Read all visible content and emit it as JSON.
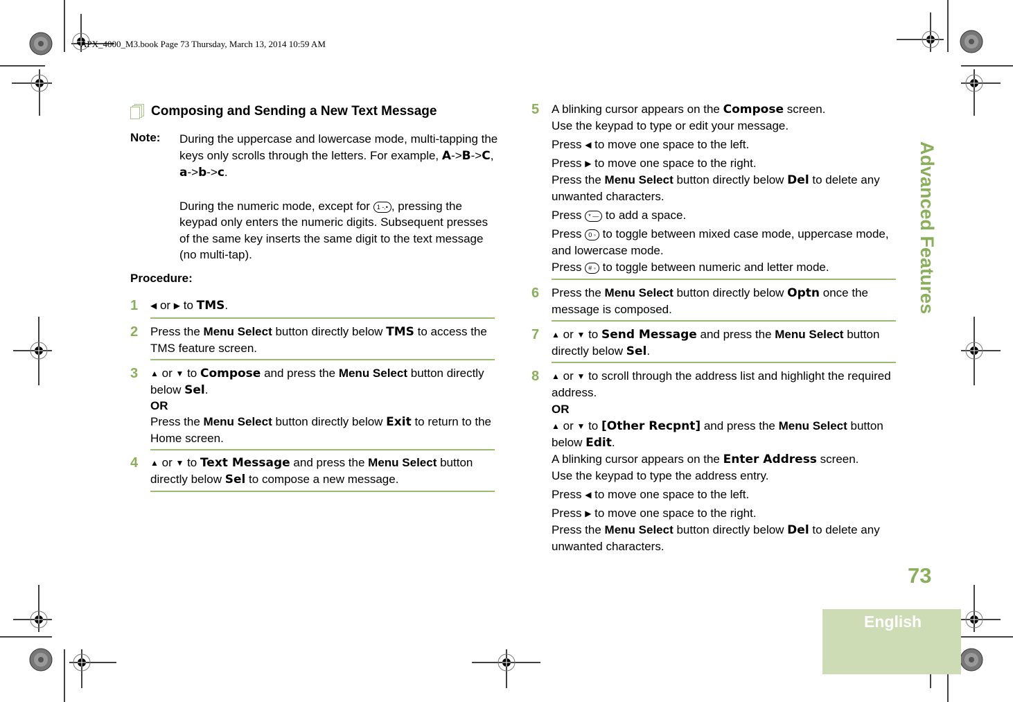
{
  "print_stamp": "APX_4000_M3.book  Page 73  Thursday, March 13, 2014  10:59 AM",
  "section": {
    "title": "Composing and Sending a New Text Message",
    "icon": "document-stack-icon"
  },
  "note": {
    "label": "Note:",
    "para1_a": "During the uppercase and lowercase mode, multi-tapping the keys only scrolls through the letters. For example, ",
    "example": [
      {
        "t": "A",
        "d": true
      },
      {
        "t": "->",
        "d": false
      },
      {
        "t": "B",
        "d": true
      },
      {
        "t": "->",
        "d": false
      },
      {
        "t": "C",
        "d": true
      },
      {
        "t": ", ",
        "d": false
      },
      {
        "t": "a",
        "d": true
      },
      {
        "t": "->",
        "d": false
      },
      {
        "t": "b",
        "d": true
      },
      {
        "t": "->",
        "d": false
      },
      {
        "t": "c",
        "d": true
      },
      {
        "t": ".",
        "d": false
      }
    ],
    "para2_a": "During the numeric mode, except for ",
    "key_1": "1 -.•",
    "para2_b": ", pressing the keypad only enters the numeric digits. Subsequent presses of the same key inserts the same digit to the text message (no multi-tap)."
  },
  "procedure_label": "Procedure:",
  "icons": {
    "left": "◀",
    "right": "▶",
    "up": "▲",
    "down": "▼"
  },
  "keys": {
    "star": "* —",
    "zero": "0 ◦",
    "hash": "# ◦"
  },
  "steps": [
    {
      "num": "1",
      "or": " or ",
      "to": " to ",
      "target": "TMS",
      "end": "."
    },
    {
      "num": "2",
      "a": "Press the ",
      "ms": "Menu Select",
      "b": " button directly below ",
      "d": "TMS",
      "c": " to access the TMS feature screen."
    },
    {
      "num": "3",
      "or": " or ",
      "to": " to ",
      "target": "Compose",
      "a": " and press the ",
      "ms": "Menu Select",
      "b": " button directly below ",
      "d": "Sel",
      "end": ".",
      "or_label": "OR",
      "alt_a": "Press the ",
      "alt_ms": "Menu Select",
      "alt_b": " button directly below ",
      "alt_d": "Exit",
      "alt_c": " to return to the Home screen."
    },
    {
      "num": "4",
      "or": " or ",
      "to": " to ",
      "target": "Text Message",
      "a": " and press the ",
      "ms": "Menu Select",
      "b": " button directly below ",
      "d": "Sel",
      "c": " to compose a new message."
    },
    {
      "num": "5",
      "a": "A blinking cursor appears on the ",
      "d": "Compose",
      "b": " screen.",
      "l2": "Use the keypad to type or edit your message.",
      "press": "Press ",
      "left_txt": " to move one space to the left.",
      "right_txt": " to move one space to the right.",
      "del_a": "Press the ",
      "del_ms": "Menu Select",
      "del_b": " button directly below ",
      "del_d": "Del",
      "del_c": " to delete any unwanted characters.",
      "space_txt": " to add a space.",
      "case_txt": " to toggle between mixed case mode, uppercase mode, and lowercase mode.",
      "num_txt": " to toggle between numeric and letter mode."
    },
    {
      "num": "6",
      "a": "Press the ",
      "ms": "Menu Select",
      "b": " button directly below ",
      "d": "Optn",
      "c": " once the message is composed."
    },
    {
      "num": "7",
      "or": " or ",
      "to": " to ",
      "target": "Send Message",
      "a": " and press the ",
      "ms": "Menu Select",
      "b": " button directly below ",
      "d": "Sel",
      "end": "."
    },
    {
      "num": "8",
      "or": " or ",
      "a": " to scroll through the address list and highlight the required address.",
      "or_label": "OR",
      "to": " to ",
      "target": "[Other Recpnt]",
      "b": " and press the ",
      "ms": "Menu Select",
      "c": " button below ",
      "d": "Edit",
      "end": ".",
      "l_cursor_a": "A blinking cursor appears on the ",
      "l_cursor_d": "Enter Address",
      "l_cursor_b": " screen.",
      "l_keypad": "Use the keypad to type the address entry.",
      "press": "Press ",
      "left_txt": " to move one space to the left.",
      "right_txt": " to move one space to the right.",
      "del_a": "Press the ",
      "del_ms": "Menu Select",
      "del_b": " button directly below ",
      "del_d": "Del",
      "del_c": " to delete any unwanted characters."
    }
  ],
  "side_tab": "Advanced Features",
  "page_number": "73",
  "language": "English",
  "colors": {
    "accent": "#8aaf5a",
    "rule": "#9bba70",
    "lang_box": "#cddcb4"
  }
}
